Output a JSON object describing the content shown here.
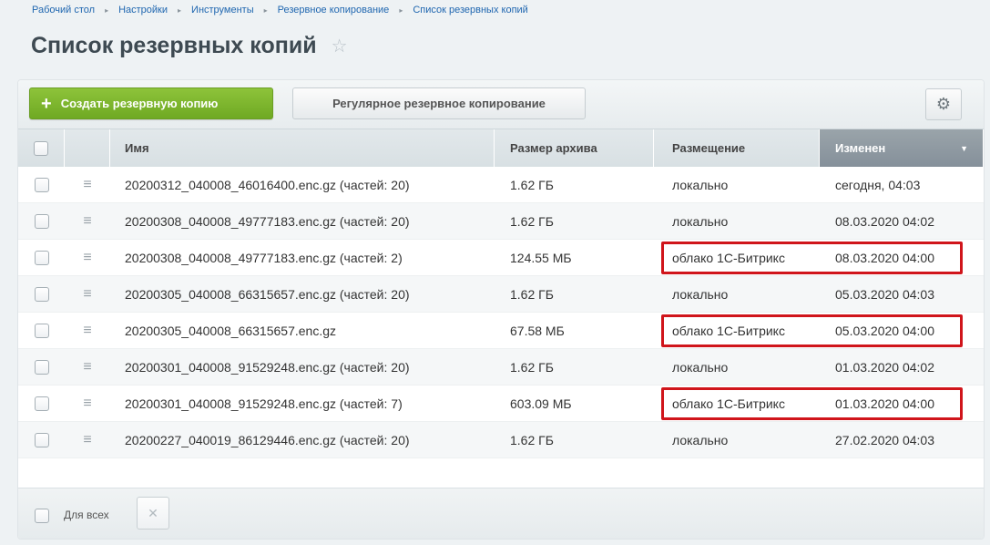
{
  "breadcrumb": [
    "Рабочий стол",
    "Настройки",
    "Инструменты",
    "Резервное копирование",
    "Список резервных копий"
  ],
  "breadcrumb_separator": "▸",
  "page": {
    "title": "Список резервных копий",
    "star_icon": "☆"
  },
  "toolbar": {
    "create_label": "Создать резервную копию",
    "create_icon": "+",
    "regular_label": "Регулярное резервное копирование",
    "gear_icon": "⚙"
  },
  "columns": {
    "name": "Имя",
    "size": "Размер архива",
    "place": "Размещение",
    "changed": "Изменен",
    "sort_icon": "▼"
  },
  "drag_icon": "≡",
  "rows": [
    {
      "name": "20200312_040008_46016400.enc.gz (частей: 20)",
      "size": "1.62 ГБ",
      "place": "локально",
      "changed": "сегодня, 04:03",
      "highlighted": false
    },
    {
      "name": "20200308_040008_49777183.enc.gz (частей: 20)",
      "size": "1.62 ГБ",
      "place": "локально",
      "changed": "08.03.2020 04:02",
      "highlighted": false
    },
    {
      "name": "20200308_040008_49777183.enc.gz (частей: 2)",
      "size": "124.55 МБ",
      "place": "облако 1С-Битрикс",
      "changed": "08.03.2020 04:00",
      "highlighted": true
    },
    {
      "name": "20200305_040008_66315657.enc.gz (частей: 20)",
      "size": "1.62 ГБ",
      "place": "локально",
      "changed": "05.03.2020 04:03",
      "highlighted": false
    },
    {
      "name": "20200305_040008_66315657.enc.gz",
      "size": "67.58 МБ",
      "place": "облако 1С-Битрикс",
      "changed": "05.03.2020 04:00",
      "highlighted": true
    },
    {
      "name": "20200301_040008_91529248.enc.gz (частей: 20)",
      "size": "1.62 ГБ",
      "place": "локально",
      "changed": "01.03.2020 04:02",
      "highlighted": false
    },
    {
      "name": "20200301_040008_91529248.enc.gz (частей: 7)",
      "size": "603.09 МБ",
      "place": "облако 1С-Битрикс",
      "changed": "01.03.2020 04:00",
      "highlighted": true
    },
    {
      "name": "20200227_040019_86129446.enc.gz (частей: 20)",
      "size": "1.62 ГБ",
      "place": "локально",
      "changed": "27.02.2020 04:03",
      "highlighted": false
    }
  ],
  "footer": {
    "for_all_label": "Для всех",
    "delete_icon": "✕"
  },
  "colors": {
    "accent_green": "#78b22b",
    "highlight_red": "#d0151b",
    "sorted_header": "#8d979f",
    "link_blue": "#2067b0"
  }
}
